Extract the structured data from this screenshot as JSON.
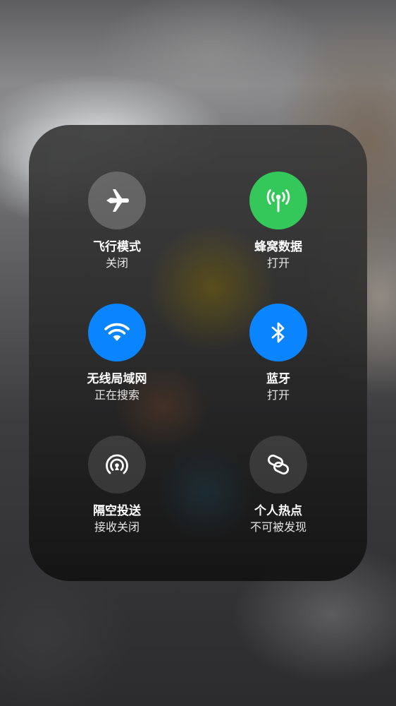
{
  "control_center": {
    "tiles": [
      {
        "label": "飞行模式",
        "status": "关闭",
        "icon": "airplane-icon",
        "state_color": "#8e8e8e"
      },
      {
        "label": "蜂窝数据",
        "status": "打开",
        "icon": "cellular-antenna-icon",
        "state_color": "#34c759"
      },
      {
        "label": "无线局域网",
        "status": "正在搜索",
        "icon": "wifi-icon",
        "state_color": "#0a84ff"
      },
      {
        "label": "蓝牙",
        "status": "打开",
        "icon": "bluetooth-icon",
        "state_color": "#0a84ff"
      },
      {
        "label": "隔空投送",
        "status": "接收关闭",
        "icon": "airdrop-icon",
        "state_color": "#6e6e6e"
      },
      {
        "label": "个人热点",
        "status": "不可被发现",
        "icon": "personal-hotspot-icon",
        "state_color": "#6e6e6e"
      }
    ]
  }
}
